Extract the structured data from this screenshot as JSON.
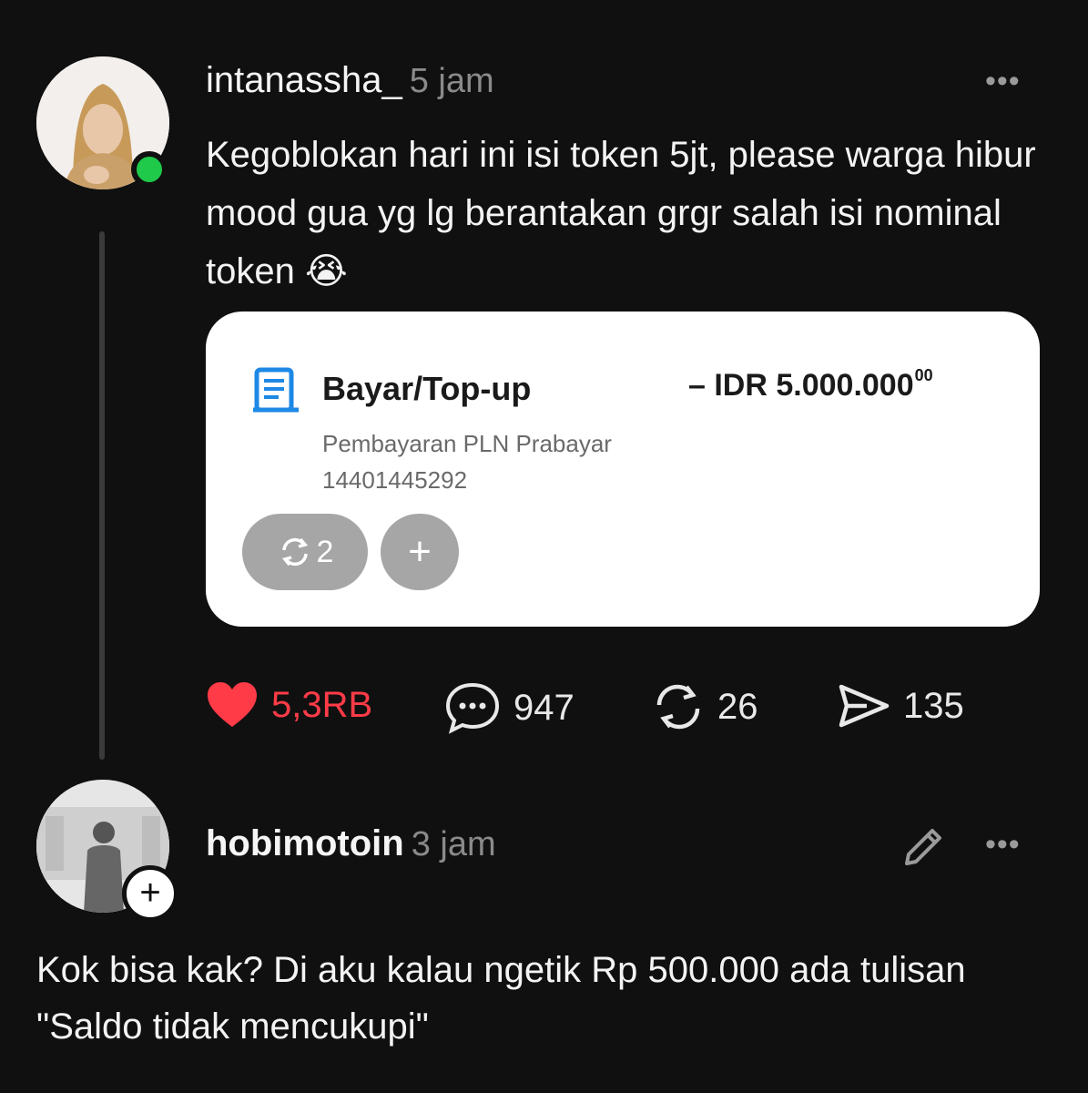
{
  "post1": {
    "username": "intanassha_",
    "time": "5 jam",
    "more": "•••",
    "text": "Kegoblokan hari ini isi token 5jt, please warga hibur mood gua yg lg berantakan grgr salah isi nominal token",
    "emoji": "😭",
    "online": true,
    "card": {
      "icon": "receipt-icon",
      "title": "Bayar/Top-up",
      "amount": "– IDR 5.000.000",
      "amount_cents": "00",
      "subtitle": "Pembayaran PLN Prabayar",
      "reference": "14401445292",
      "reload_count": "2",
      "add_label": "+"
    },
    "actions": {
      "likes": "5,3RB",
      "comments": "947",
      "reposts": "26",
      "shares": "135"
    }
  },
  "post2": {
    "username": "hobimotoin",
    "time": "3 jam",
    "more": "•••",
    "follow_label": "+",
    "text": "Kok bisa kak? Di aku kalau ngetik Rp 500.000 ada tulisan \"Saldo tidak mencukupi\""
  },
  "colors": {
    "background": "#101010",
    "like": "#ff3b47",
    "online": "#1fc94a",
    "card_icon": "#1e88e5"
  }
}
